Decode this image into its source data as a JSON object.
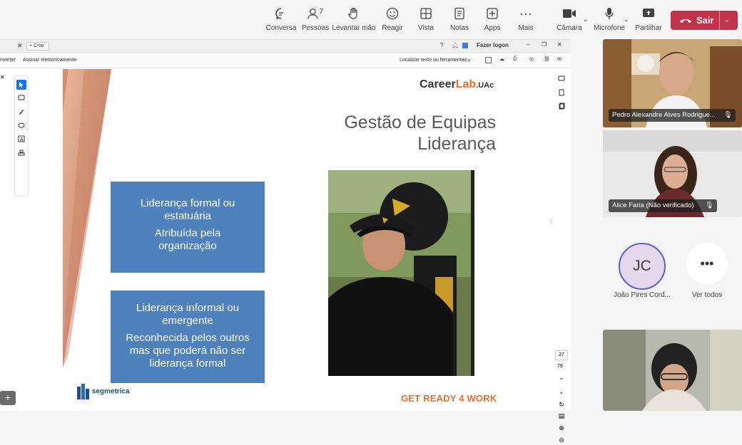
{
  "toolbar": {
    "items": [
      {
        "label": "Conversa",
        "icon": "chat-icon"
      },
      {
        "label": "Pessoas",
        "icon": "people-icon",
        "badge": "7"
      },
      {
        "label": "Levantar mão",
        "icon": "raise-hand-icon"
      },
      {
        "label": "Reagir",
        "icon": "react-icon"
      },
      {
        "label": "Vista",
        "icon": "view-icon"
      },
      {
        "label": "Notas",
        "icon": "notes-icon"
      },
      {
        "label": "Apps",
        "icon": "apps-icon"
      },
      {
        "label": "Mais",
        "icon": "more-icon"
      },
      {
        "label": "Câmara",
        "icon": "camera-icon"
      },
      {
        "label": "Microfone",
        "icon": "microphone-icon"
      },
      {
        "label": "Partilhar",
        "icon": "share-icon"
      }
    ],
    "leave_label": "Sair"
  },
  "pdf": {
    "new_tab": "Criar",
    "signin": "Fazer logon",
    "tool_convert": "nverter",
    "tool_sign": "Assinar eletronicamente",
    "search_tools": "Localizar texto ou ferramentas",
    "page_current": "27",
    "page_total": "79"
  },
  "slide": {
    "brand_career": "Career",
    "brand_lab": "Lab",
    "brand_uac": ".UAc",
    "title_line1": "Gestão de Equipas",
    "title_line2": "Liderança",
    "box1_line1": "Liderança formal ou estatuária",
    "box1_line2": "Atribuída pela organização",
    "box2_line1": "Liderança informal ou emergente",
    "box2_line2": "Reconhecida pelos outros mas que poderá não ser liderança formal",
    "footer": "GET READY 4 WORK",
    "logo": "segmetrica"
  },
  "participants": {
    "p1": "Pedro Alexandre Alves Rodrigue...",
    "p2": "Alice Faria (Não verificado)",
    "p3_initials": "JC",
    "p3_name": "João Pires Cord...",
    "see_all": "Ver todos"
  },
  "colors": {
    "leave": "#c4314b",
    "slide_blue": "#4f81bd",
    "accent_orange": "#e86f2b",
    "avatar_ring": "#5b5fc7"
  }
}
